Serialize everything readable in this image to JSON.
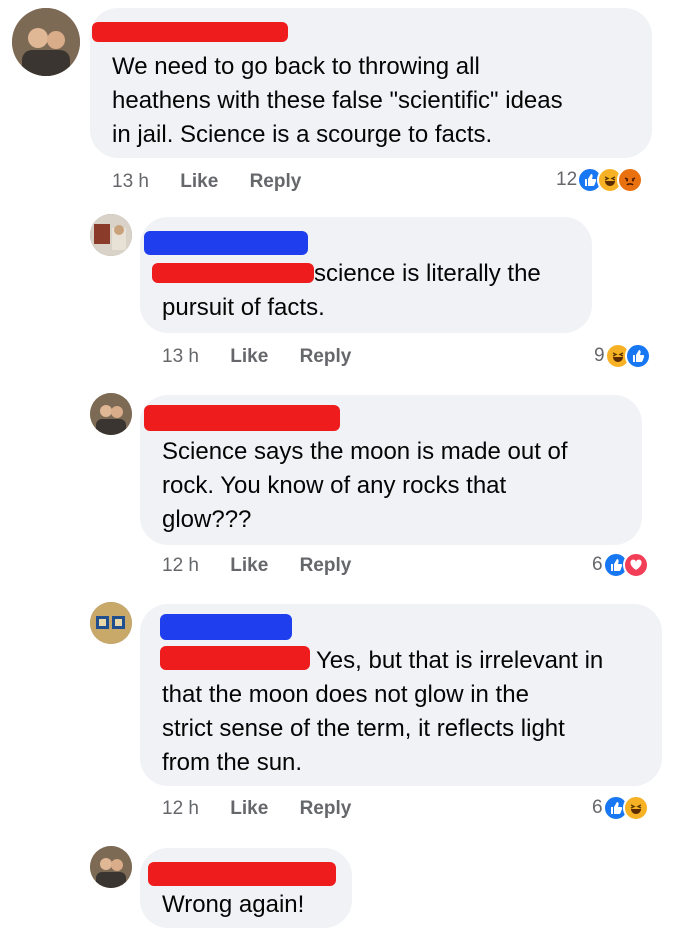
{
  "comments": [
    {
      "text_lines": [
        "We need to go back to throwing all",
        "heathens with these false \"scientific\" ideas",
        "in jail. Science is a scourge to facts."
      ],
      "time": "13 h",
      "like": "Like",
      "reply": "Reply",
      "reaction_count": "12",
      "reactions": [
        "like",
        "haha",
        "angry"
      ]
    },
    {
      "text_lines": [
        "science is literally the",
        "pursuit of facts."
      ],
      "time": "13 h",
      "like": "Like",
      "reply": "Reply",
      "reaction_count": "9",
      "reactions": [
        "haha",
        "like"
      ]
    },
    {
      "text_lines": [
        "Science says the moon is made out of",
        "rock. You know of any rocks that",
        "glow???"
      ],
      "time": "12 h",
      "like": "Like",
      "reply": "Reply",
      "reaction_count": "6",
      "reactions": [
        "like",
        "love"
      ]
    },
    {
      "text_lines": [
        "Yes, but that is irrelevant in",
        "that the moon does not glow in the",
        "strict sense of the term, it reflects light",
        "from the sun."
      ],
      "time": "12 h",
      "like": "Like",
      "reply": "Reply",
      "reaction_count": "6",
      "reactions": [
        "like",
        "haha"
      ]
    },
    {
      "text_lines": [
        "Wrong again!"
      ]
    }
  ],
  "colors": {
    "redaction_red": "#ee1c1c",
    "redaction_blue": "#1f3fee",
    "bubble": "#f0f2f5",
    "meta_gray": "#65676b",
    "like_blue": "#1877f2",
    "haha_yellow": "#f7b125"
  }
}
